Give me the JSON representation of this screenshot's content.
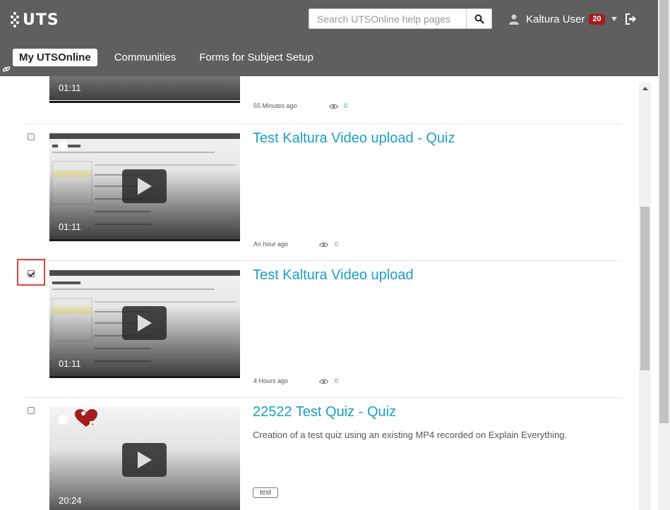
{
  "header": {
    "logo_text": "UTS",
    "search_placeholder": "Search UTSOnline help pages",
    "user_name": "Kaltura User",
    "notification_count": "20"
  },
  "nav": {
    "tabs": [
      {
        "label": "My UTSOnline",
        "active": true
      },
      {
        "label": "Communities",
        "active": false
      },
      {
        "label": "Forms for Subject Setup",
        "active": false
      }
    ]
  },
  "entries": [
    {
      "title": "",
      "duration": "01:11",
      "time": "55 Minutes ago",
      "views": "0",
      "checked": false
    },
    {
      "title": "Test Kaltura Video upload - Quiz",
      "duration": "01:11",
      "time": "An hour ago",
      "views": "0",
      "checked": false
    },
    {
      "title": "Test Kaltura Video upload",
      "duration": "01:11",
      "time": "4 Hours ago",
      "views": "0",
      "checked": true
    },
    {
      "title": "22522 Test Quiz - Quiz",
      "duration": "20:24",
      "description": "Creation of a test quiz using an existing MP4 recorded on Explain Everything.",
      "tag": "test",
      "checked": false
    }
  ],
  "colors": {
    "header_bg": "#5f5f5f",
    "link": "#1a9ec9",
    "badge": "#a51c1c",
    "highlight": "#d9453d"
  }
}
